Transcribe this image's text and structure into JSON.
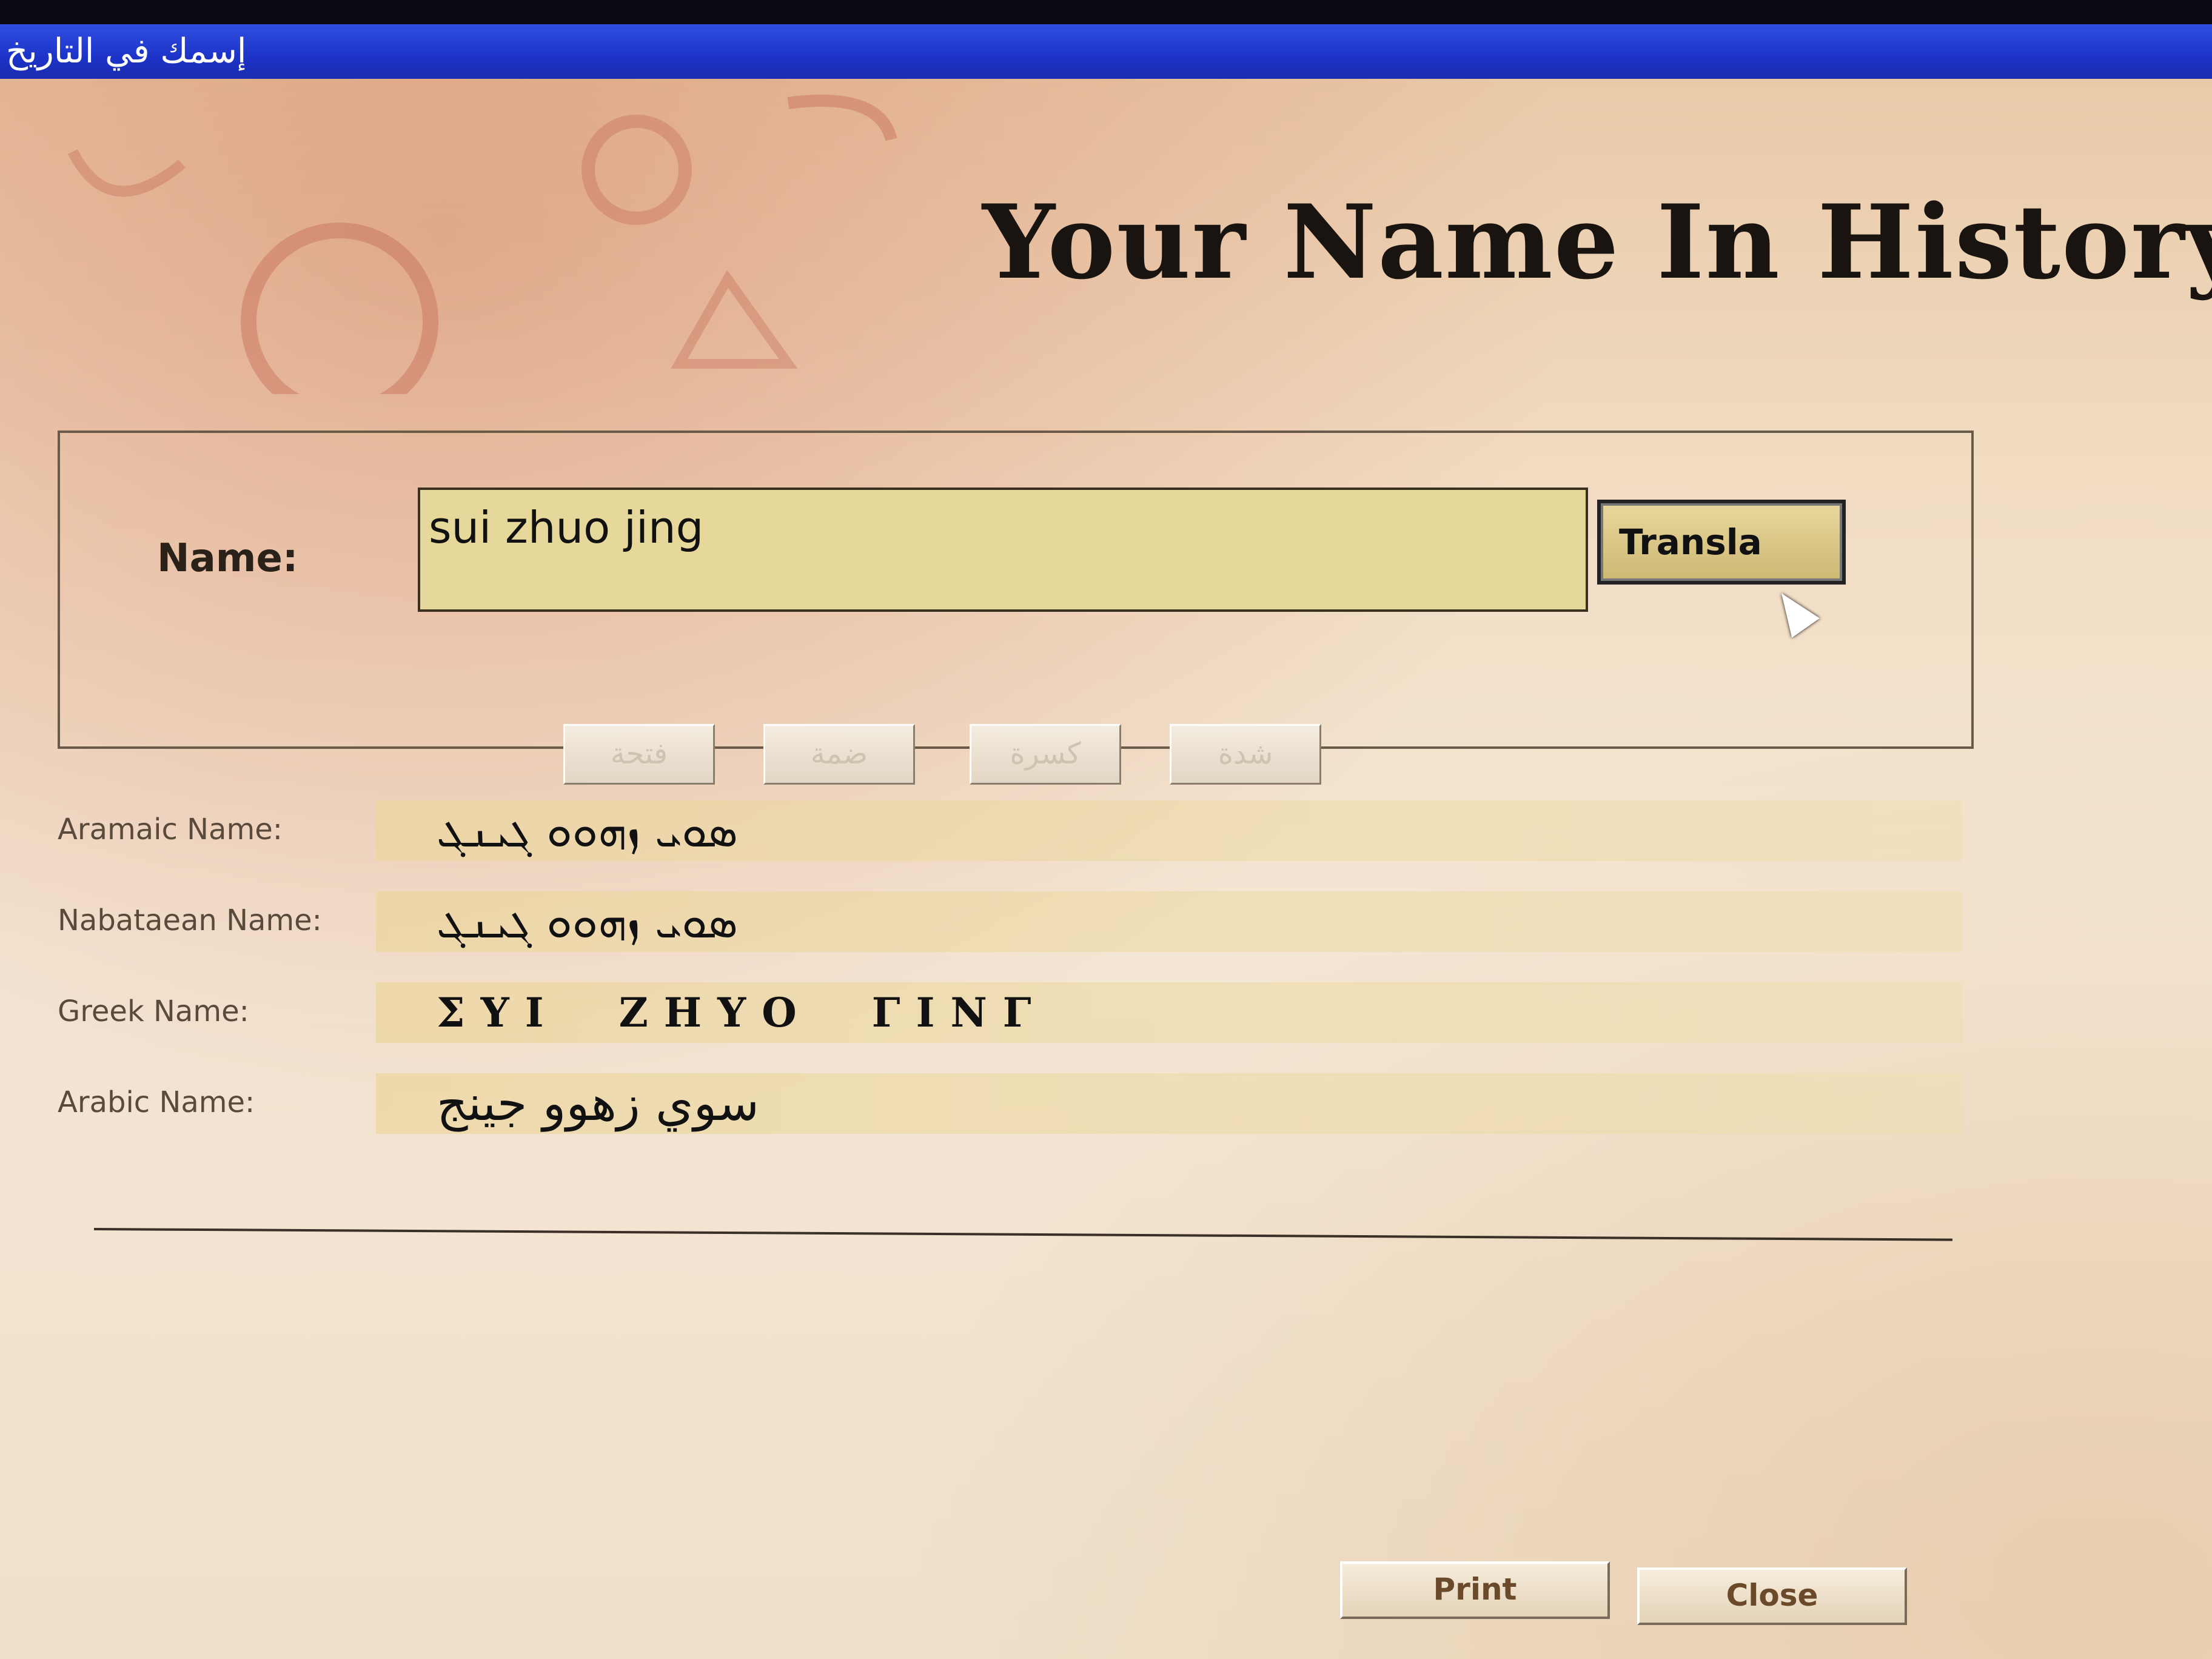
{
  "window": {
    "title": "إسمك في التاريخ"
  },
  "app": {
    "title": "Your Name In History"
  },
  "form": {
    "name_label": "Name:",
    "name_value": "sui zhuo jing",
    "translate_label": "Transla",
    "diacritics": [
      "فتحة",
      "ضمة",
      "كسرة",
      "شدة"
    ]
  },
  "results": [
    {
      "label": "Aramaic Name:",
      "value": "ܣܘܝ ܙܗܘܘ ܓܝܢܓ",
      "script": "aramaic"
    },
    {
      "label": "Nabataean Name:",
      "value": "ܣܘܝ ܙܗܘܘ ܓܝܢܓ",
      "script": "nabataean"
    },
    {
      "label": "Greek Name:",
      "value": "ΣΥΙ  ΖΗΥΟ  ΓΙΝΓ",
      "script": "greek"
    },
    {
      "label": "Arabic Name:",
      "value": "سوي زهوو جينج",
      "script": "arabic"
    }
  ],
  "actions": {
    "print_label": "Print",
    "close_label": "Close"
  },
  "icons": {
    "cursor": "mouse-pointer-icon"
  }
}
